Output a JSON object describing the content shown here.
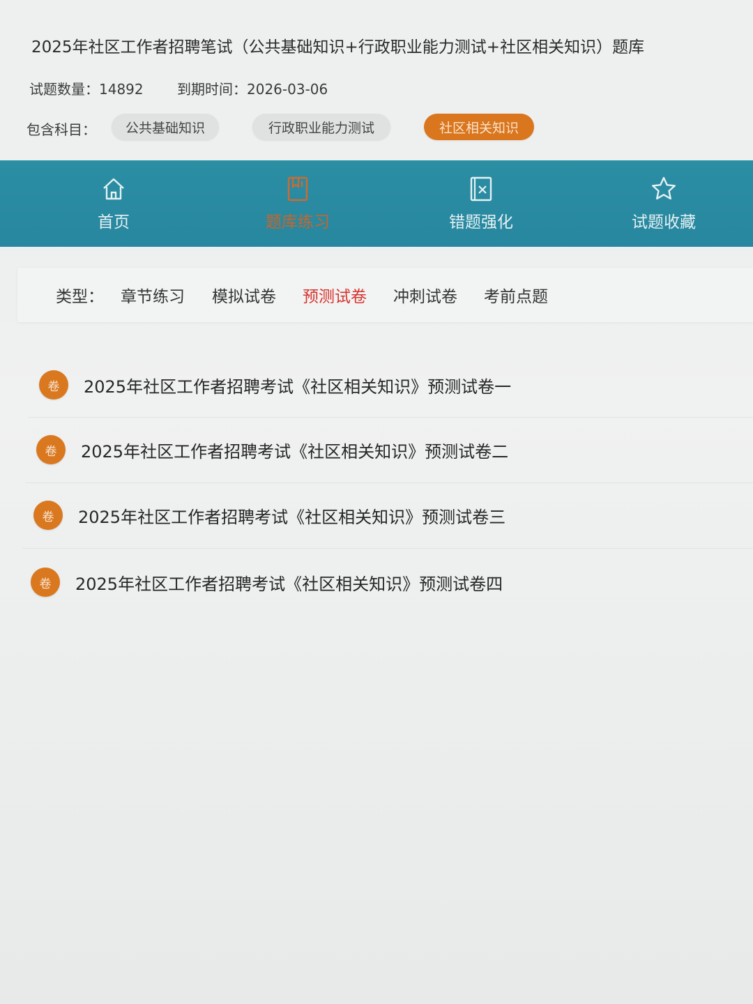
{
  "header": {
    "title": "2025年社区工作者招聘笔试（公共基础知识+行政职业能力测试+社区相关知识）题库",
    "question_count": "试题数量：14892",
    "expire_date": "到期时间：2026-03-06",
    "subjects_label": "包含科目：",
    "subjects": [
      "公共基础知识",
      "行政职业能力测试",
      "社区相关知识"
    ]
  },
  "nav": {
    "items": [
      {
        "label": "首页",
        "icon": "home-icon"
      },
      {
        "label": "题库练习",
        "icon": "book-icon"
      },
      {
        "label": "错题强化",
        "icon": "wrong-book-icon"
      },
      {
        "label": "试题收藏",
        "icon": "star-icon"
      }
    ]
  },
  "types": {
    "label": "类型：",
    "items": [
      "章节练习",
      "模拟试卷",
      "预测试卷",
      "冲刺试卷",
      "考前点题"
    ]
  },
  "papers": {
    "badge": "卷",
    "items": [
      "2025年社区工作者招聘考试《社区相关知识》预测试卷一",
      "2025年社区工作者招聘考试《社区相关知识》预测试卷二",
      "2025年社区工作者招聘考试《社区相关知识》预测试卷三",
      "2025年社区工作者招聘考试《社区相关知识》预测试卷四"
    ]
  },
  "colors": {
    "accent_orange": "#d9781f",
    "nav_teal": "#2b8ea3",
    "active_red": "#d6342d"
  }
}
